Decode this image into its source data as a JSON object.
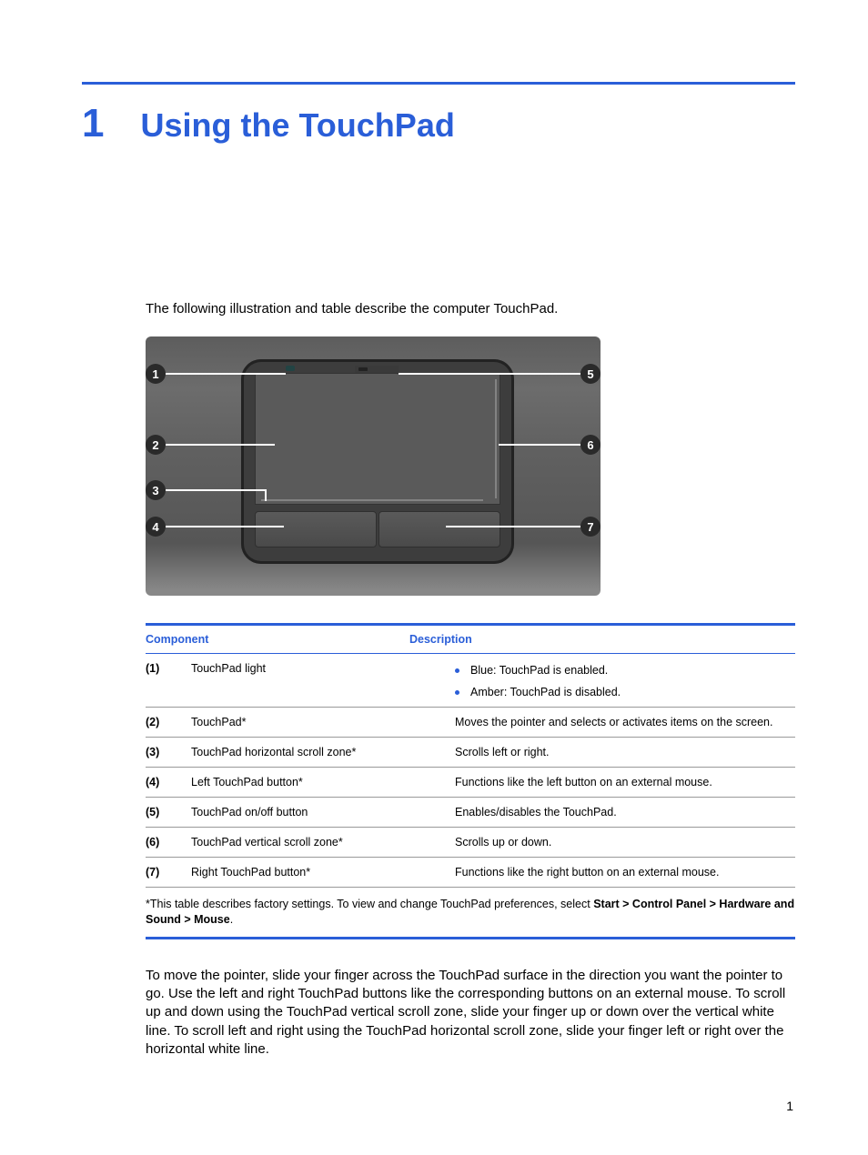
{
  "chapter": {
    "number": "1",
    "title": "Using the TouchPad"
  },
  "intro": "The following illustration and table describe the computer TouchPad.",
  "callouts": [
    "1",
    "2",
    "3",
    "4",
    "5",
    "6",
    "7"
  ],
  "table": {
    "head_component": "Component",
    "head_description": "Description",
    "rows": [
      {
        "num": "(1)",
        "comp": "TouchPad light",
        "bullets": [
          "Blue: TouchPad is enabled.",
          "Amber: TouchPad is disabled."
        ]
      },
      {
        "num": "(2)",
        "comp": "TouchPad*",
        "desc": "Moves the pointer and selects or activates items on the screen."
      },
      {
        "num": "(3)",
        "comp": "TouchPad horizontal scroll zone*",
        "desc": "Scrolls left or right."
      },
      {
        "num": "(4)",
        "comp": "Left TouchPad button*",
        "desc": "Functions like the left button on an external mouse."
      },
      {
        "num": "(5)",
        "comp": "TouchPad on/off button",
        "desc": "Enables/disables the TouchPad."
      },
      {
        "num": "(6)",
        "comp": "TouchPad vertical scroll zone*",
        "desc": "Scrolls up or down."
      },
      {
        "num": "(7)",
        "comp": "Right TouchPad button*",
        "desc": "Functions like the right button on an external mouse."
      }
    ],
    "footnote_pre": "*This table describes factory settings. To view and change TouchPad preferences, select ",
    "footnote_bold": "Start > Control Panel > Hardware and Sound > Mouse",
    "footnote_post": "."
  },
  "body_para": "To move the pointer, slide your finger across the TouchPad surface in the direction you want the pointer to go. Use the left and right TouchPad buttons like the corresponding buttons on an external mouse. To scroll up and down using the TouchPad vertical scroll zone, slide your finger up or down over the vertical white line. To scroll left and right using the TouchPad horizontal scroll zone, slide your finger left or right over the horizontal white line.",
  "page_number": "1"
}
